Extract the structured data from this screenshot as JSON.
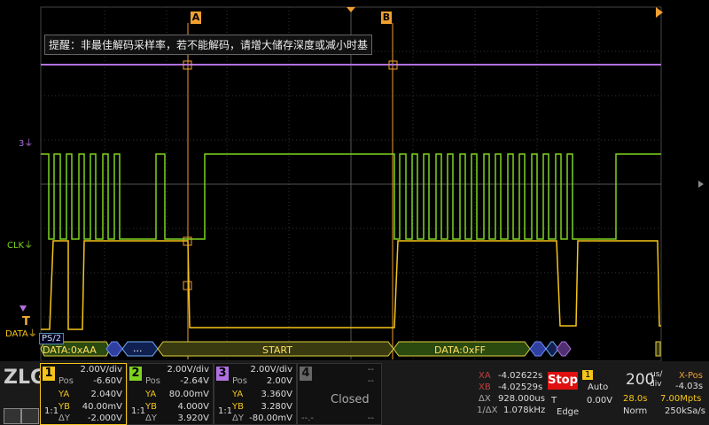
{
  "tip": "提醒：非最佳解码采样率，若不能解码，请增大储存深度或减小时基",
  "cursors": {
    "a": "A",
    "b": "B"
  },
  "labels": {
    "ch3": "3",
    "clk": "CLK",
    "data": "DATA",
    "ps2": "PS/2",
    "trig": "T"
  },
  "decode": {
    "d1": "DATA:0xAA",
    "dots": "...",
    "start": "START",
    "d2": "DATA:0xFF"
  },
  "ch1": {
    "num": "1",
    "scale": "2.00V/div",
    "pos_label": "Pos",
    "pos": "-6.60V",
    "ya_label": "YA",
    "ya": "2.040V",
    "yb_label": "YB",
    "yb": "40.00mV",
    "dy_label": "ΔY",
    "dy": "-2.000V",
    "ratio": "1:1",
    "color": "#f5c518"
  },
  "ch2": {
    "num": "2",
    "scale": "2.00V/div",
    "pos_label": "Pos",
    "pos": "-2.64V",
    "ya_label": "YA",
    "ya": "80.00mV",
    "yb_label": "YB",
    "yb": "4.000V",
    "dy_label": "ΔY",
    "dy": "3.920V",
    "ratio": "1:1",
    "color": "#7ed321"
  },
  "ch3": {
    "num": "3",
    "scale": "2.00V/div",
    "pos_label": "Pos",
    "pos": "2.00V",
    "ya_label": "YA",
    "ya": "3.360V",
    "yb_label": "YB",
    "yb": "3.280V",
    "dy_label": "ΔY",
    "dy": "-80.00mV",
    "ratio": "1:1",
    "color": "#b070e0"
  },
  "ch4": {
    "num": "4",
    "status": "Closed",
    "dash": "--",
    "dash_small": "--.-"
  },
  "meas": {
    "xa_label": "XA",
    "xa": "-4.02622s",
    "xb_label": "XB",
    "xb": "-4.02529s",
    "dx_label": "ΔX",
    "dx": "928.000us",
    "f_label": "1/ΔX",
    "f": "1.078kHz"
  },
  "acq": {
    "state": "Stop",
    "ch": "1",
    "mode": "Auto",
    "t_label": "T",
    "level": "0.00V",
    "edge": "Edge"
  },
  "timebase": {
    "value": "200",
    "unit_top": "us/",
    "unit_bot": "div",
    "xpos_label": "X-Pos",
    "xpos": "-4.03s",
    "time": "28.0s",
    "depth": "7.00Mpts",
    "norm": "Norm",
    "rate": "250kSa/s"
  }
}
